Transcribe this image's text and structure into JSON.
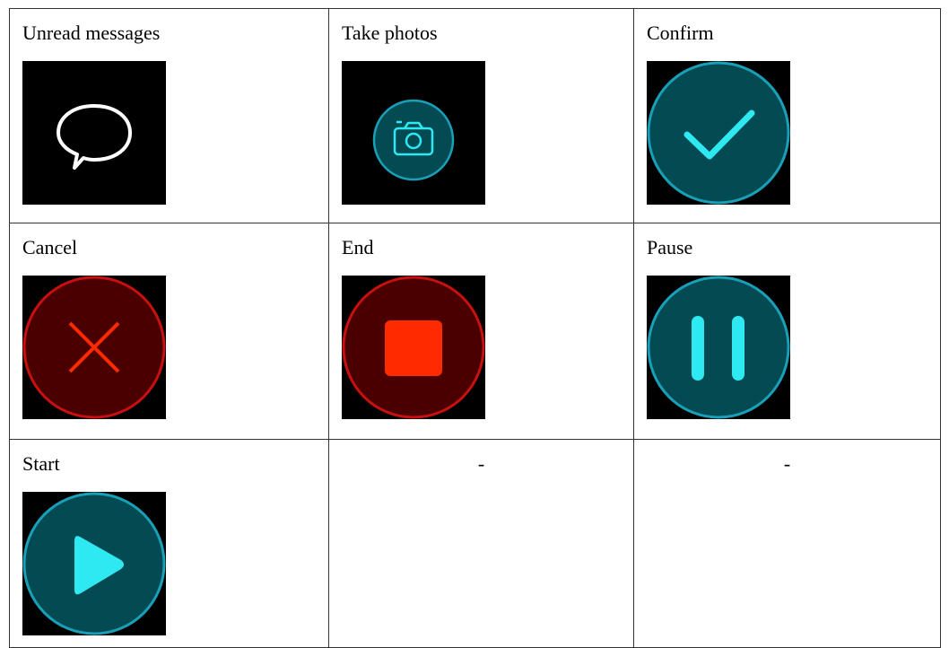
{
  "cells": [
    {
      "label": "Unread messages",
      "icon": "speech-bubble-icon"
    },
    {
      "label": "Take photos",
      "icon": "camera-icon"
    },
    {
      "label": "Confirm",
      "icon": "checkmark-icon"
    },
    {
      "label": "Cancel",
      "icon": "close-x-icon"
    },
    {
      "label": "End",
      "icon": "stop-icon"
    },
    {
      "label": "Pause",
      "icon": "pause-icon"
    },
    {
      "label": "Start",
      "icon": "play-icon"
    },
    {
      "label": "-"
    },
    {
      "label": "-"
    }
  ],
  "colors": {
    "tile_background": "#000000",
    "teal_fill": "#044a52",
    "teal_ring": "#19a0b8",
    "cyan_glyph": "#2ee8f2",
    "red_fill": "#4a0000",
    "red_ring": "#c81010",
    "red_glyph": "#ff2a00",
    "white_glyph": "#ffffff"
  }
}
